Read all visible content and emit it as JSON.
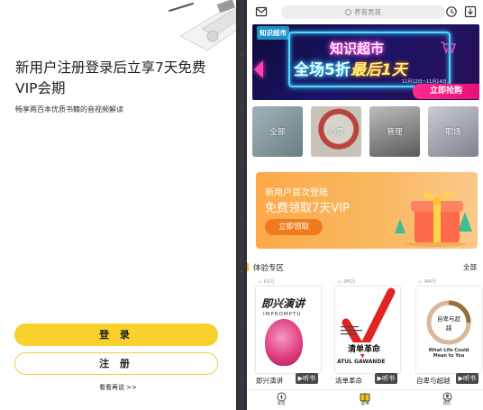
{
  "login_screen": {
    "promo_title": "新用户注册登录后立享7天免费VIP会期",
    "promo_subtitle": "畅享两百本优质书籍的音视频解读",
    "login_button": "登 录",
    "register_button": "注 册",
    "browse_link": "看看再说 >>"
  },
  "home": {
    "search": {
      "placeholder": "养育男孩"
    },
    "header_icons": [
      "mail-icon",
      "history-icon",
      "download-icon"
    ],
    "banner": {
      "logo": "知识超市",
      "headline": "知识超市",
      "offer_prefix": "全场5折",
      "offer_highlight": "最后1天",
      "date": "11月12日~11月14日",
      "cta": "立即抢购"
    },
    "categories": [
      {
        "label": "全部",
        "color": "#8ba1a8"
      },
      {
        "label": "心灵",
        "color": "#c75f5a"
      },
      {
        "label": "管理",
        "color": "#6f6f6f"
      },
      {
        "label": "职场",
        "color": "#8a8f99"
      }
    ],
    "vip_card": {
      "line1": "新用户首次登陆",
      "line2": "免费领取7天VIP",
      "button": "立即领取"
    },
    "section": {
      "title": "体验专区",
      "more": "全部"
    },
    "books": [
      {
        "count": "63万",
        "title": "即兴演讲",
        "cover_text": "即兴演讲",
        "cover_sub": "IMPROMPTU",
        "listen": "▶听书"
      },
      {
        "count": "3M万",
        "title": "清单革命",
        "cover_text": "清单革命",
        "cover_sub": "ATUL GAWANDE",
        "listen": "▶听书"
      },
      {
        "count": "4M万",
        "title": "自卑与超越",
        "cover_text": "自卑与超越",
        "cover_sub": "What Life Could Mean to You",
        "listen": "▶听书"
      }
    ],
    "tabs": [
      {
        "label": "发现",
        "icon": "compass-icon"
      },
      {
        "label": "读书",
        "icon": "book-icon",
        "active": true
      },
      {
        "label": "我的",
        "icon": "profile-icon"
      }
    ]
  }
}
